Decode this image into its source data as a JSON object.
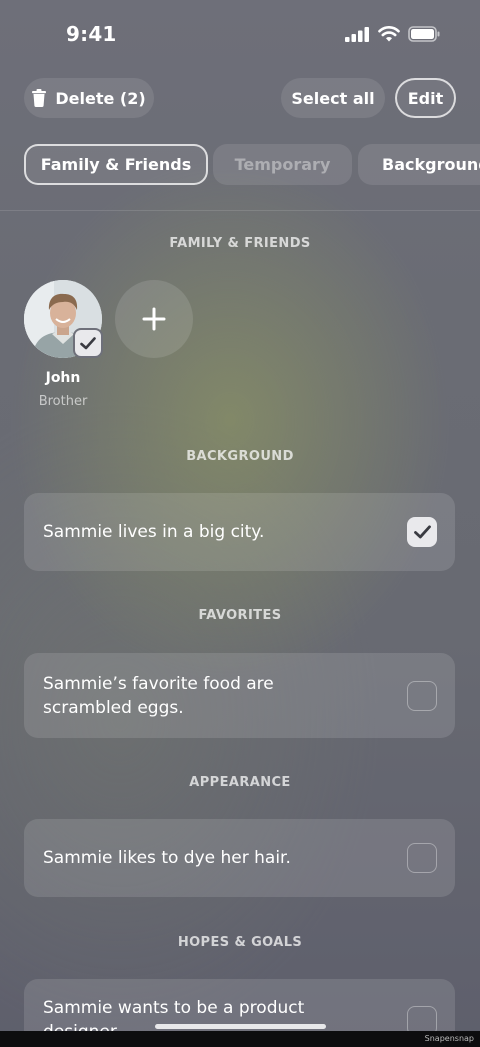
{
  "status_bar": {
    "time": "9:41"
  },
  "toolbar": {
    "delete_label": "Delete (2)",
    "select_all_label": "Select all",
    "edit_label": "Edit"
  },
  "tabs": [
    {
      "label": "Family & Friends",
      "active": true
    },
    {
      "label": "Temporary",
      "active": false
    },
    {
      "label": "Background",
      "active": false
    }
  ],
  "sections": {
    "family": {
      "title": "FAMILY & FRIENDS",
      "people": [
        {
          "name": "John",
          "relation": "Brother",
          "selected": true
        }
      ]
    },
    "background": {
      "title": "BACKGROUND",
      "item": {
        "text": "Sammie lives in a big city.",
        "checked": true
      }
    },
    "favorites": {
      "title": "FAVORITES",
      "item": {
        "text": "Sammie’s favorite food are scrambled eggs.",
        "checked": false
      }
    },
    "appearance": {
      "title": "APPEARANCE",
      "item": {
        "text": "Sammie likes to dye her hair.",
        "checked": false
      }
    },
    "hopes_goals": {
      "title": "HOPES & GOALS",
      "item": {
        "text": "Sammie wants to be a product designer.",
        "checked": false
      }
    }
  },
  "watermark": "Snapensnap",
  "colors": {
    "checkbox_on": "#e9e9ec",
    "footer": "#0d0d0f"
  }
}
